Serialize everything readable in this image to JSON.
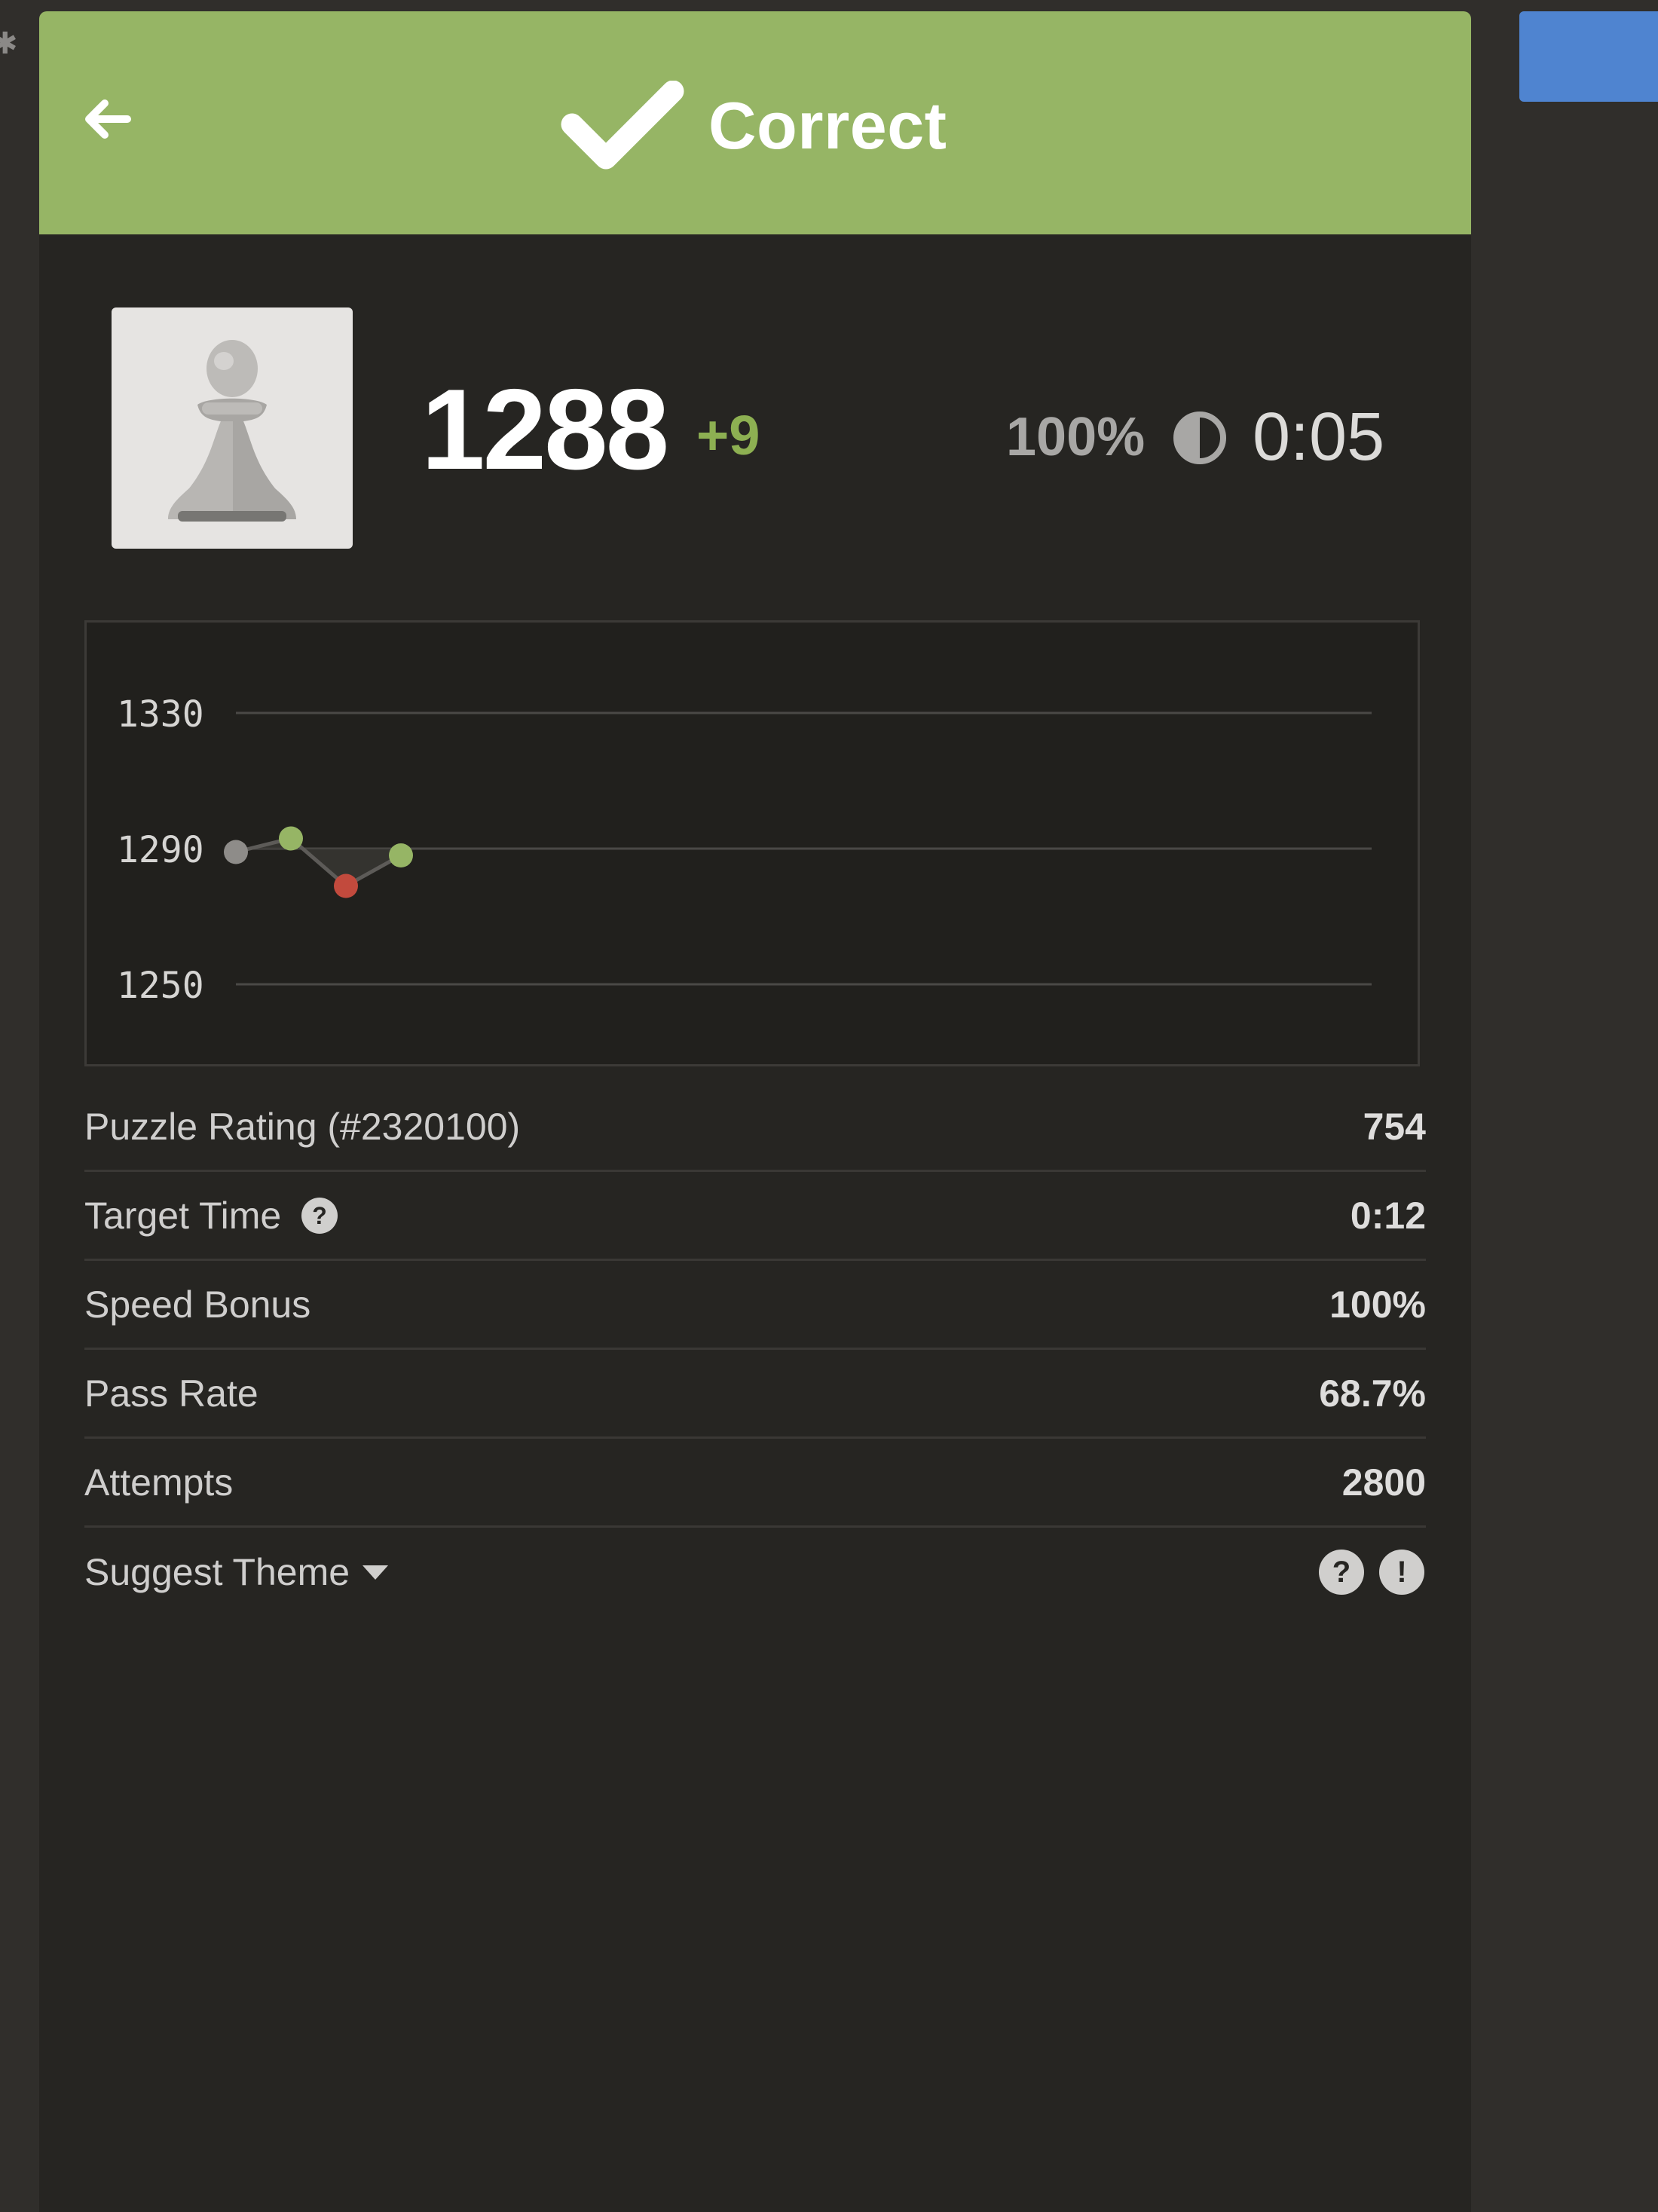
{
  "header": {
    "title": "Correct",
    "background_color": "#96b565"
  },
  "rating": {
    "value": "1288",
    "delta": "+9",
    "delta_color": "#8db052"
  },
  "performance": {
    "accuracy": "100%",
    "elapsed_time": "0:05"
  },
  "chart_data": {
    "type": "line",
    "y_ticks": [
      "1330",
      "1290",
      "1250"
    ],
    "ylim": [
      1250,
      1330
    ],
    "grid": true,
    "points": [
      {
        "x": 1,
        "y": 1289,
        "result": "start",
        "color": "#8e8c89"
      },
      {
        "x": 2,
        "y": 1293,
        "result": "correct",
        "color": "#96b565"
      },
      {
        "x": 3,
        "y": 1279,
        "result": "incorrect",
        "color": "#c24a3d"
      },
      {
        "x": 4,
        "y": 1288,
        "result": "correct",
        "color": "#96b565"
      }
    ]
  },
  "stats": {
    "puzzle_rating_label": "Puzzle Rating (#2320100)",
    "puzzle_rating_value": "754",
    "target_time_label": "Target Time",
    "target_time_value": "0:12",
    "speed_bonus_label": "Speed Bonus",
    "speed_bonus_value": "100%",
    "pass_rate_label": "Pass Rate",
    "pass_rate_value": "68.7%",
    "attempts_label": "Attempts",
    "attempts_value": "2800"
  },
  "theme": {
    "suggest_label": "Suggest Theme"
  },
  "icons": {
    "back": "arrow-left-icon",
    "header": "checkmark-icon",
    "avatar": "pawn-icon",
    "time": "half-circle-clock-icon",
    "help": "question-circle-icon",
    "report": "exclamation-circle-icon",
    "dropdown": "caret-down-icon"
  }
}
